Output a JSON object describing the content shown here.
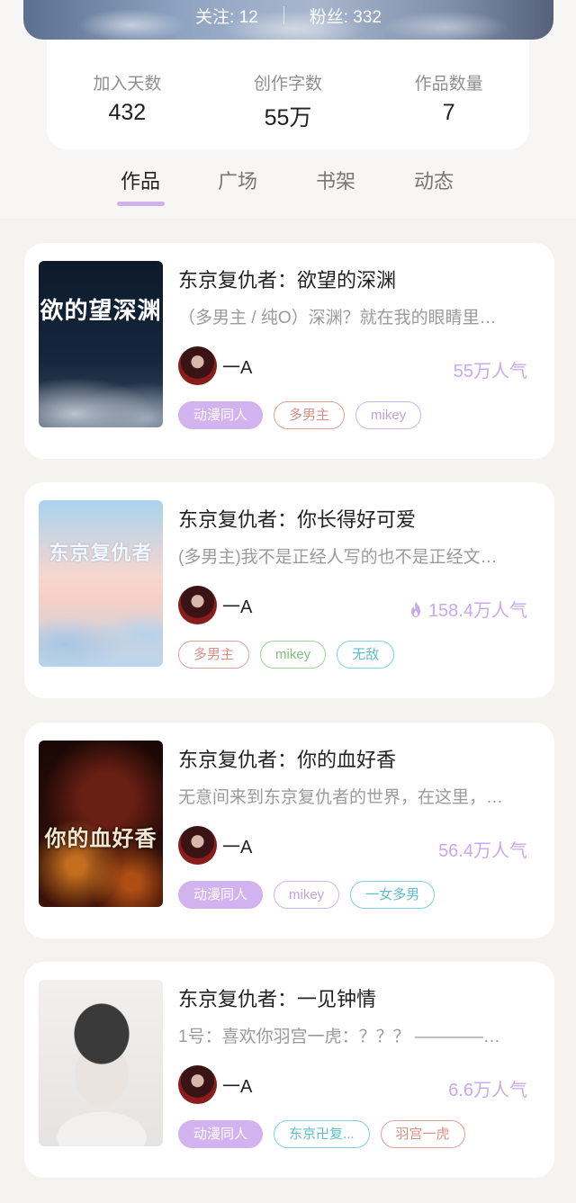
{
  "header": {
    "follow_label": "关注: 12",
    "fans_label": "粉丝: 332"
  },
  "stats": [
    {
      "label": "加入天数",
      "value": "432"
    },
    {
      "label": "创作字数",
      "value": "55万"
    },
    {
      "label": "作品数量",
      "value": "7"
    }
  ],
  "tabs": [
    {
      "label": "作品",
      "active": true
    },
    {
      "label": "广场",
      "active": false
    },
    {
      "label": "书架",
      "active": false
    },
    {
      "label": "动态",
      "active": false
    }
  ],
  "works": [
    {
      "title": "东京复仇者：欲望的深渊",
      "description": "（多男主 / 纯O）深渊？就在我的眼睛里…",
      "author": "一A",
      "popularity": "55万人气",
      "hot": false,
      "cover_text": "欲的望深渊",
      "tags": [
        {
          "label": "动漫同人",
          "style": "purple-fill"
        },
        {
          "label": "多男主",
          "style": "red"
        },
        {
          "label": "mikey",
          "style": "lilac"
        }
      ]
    },
    {
      "title": "东京复仇者：你长得好可爱",
      "description": "(多男主)我不是正经人写的也不是正经文…",
      "author": "一A",
      "popularity": "158.4万人气",
      "hot": true,
      "cover_text": "东京复仇者",
      "tags": [
        {
          "label": "多男主",
          "style": "red"
        },
        {
          "label": "mikey",
          "style": "green"
        },
        {
          "label": "无敌",
          "style": "cyan"
        }
      ]
    },
    {
      "title": "东京复仇者：你的血好香",
      "description": "无意间来到东京复仇者的世界，在这里，…",
      "author": "一A",
      "popularity": "56.4万人气",
      "hot": false,
      "cover_text": "你的血好香",
      "tags": [
        {
          "label": "动漫同人",
          "style": "purple-fill"
        },
        {
          "label": "mikey",
          "style": "lilac"
        },
        {
          "label": "一女多男",
          "style": "cyan"
        }
      ]
    },
    {
      "title": "东京复仇者：一见钟情",
      "description": "1号：喜欢你羽宫一虎：？？？ ————…",
      "author": "一A",
      "popularity": "6.6万人气",
      "hot": false,
      "cover_text": "",
      "tags": [
        {
          "label": "动漫同人",
          "style": "purple-fill"
        },
        {
          "label": "东京卍复...",
          "style": "cyan"
        },
        {
          "label": "羽宫一虎",
          "style": "red"
        }
      ]
    }
  ],
  "colors": {
    "accent": "#cdb3ea",
    "popularity": "#c9a9ec",
    "background": "#f4f3ef"
  }
}
